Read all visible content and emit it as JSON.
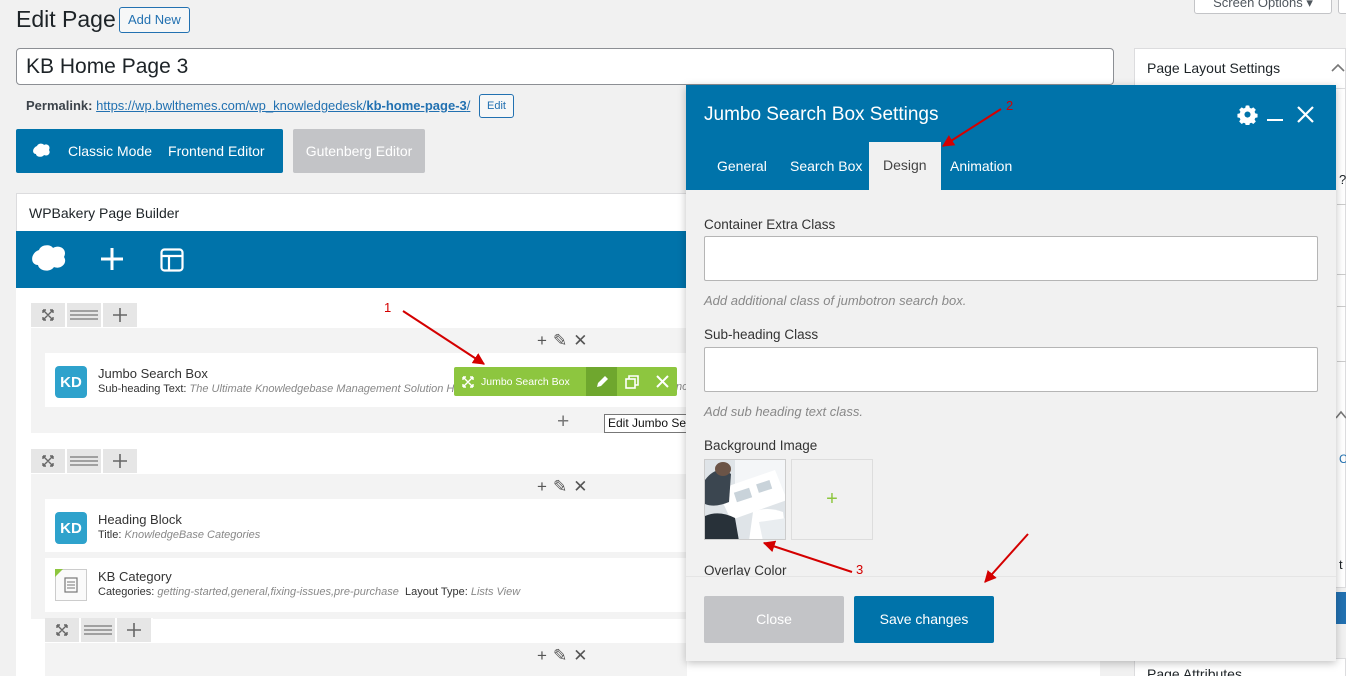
{
  "header": {
    "title": "Edit Page",
    "add_new": "Add New",
    "screen_options": "Screen Options ▾"
  },
  "post": {
    "title": "KB Home Page 3",
    "permalink_label": "Permalink:",
    "permalink_base": "https://wp.bwlthemes.com/wp_knowledgedesk/",
    "permalink_slug": "kb-home-page-3",
    "permalink_end": "/",
    "permalink_edit": "Edit"
  },
  "modes": {
    "classic": "Classic Mode",
    "frontend": "Frontend Editor",
    "gutenberg": "Gutenberg Editor"
  },
  "builder": {
    "title": "WPBakery Page Builder",
    "elements": [
      {
        "badge": "KD",
        "title": "Jumbo Search Box",
        "meta_label": "Sub-heading Text:",
        "meta_value": "The Ultimate Knowledgebase Management Solution H"
      },
      {
        "badge": "KD",
        "title": "Heading Block",
        "meta_label": "Title:",
        "meta_value": "KnowledgeBase Categories"
      },
      {
        "title": "KB Category",
        "meta_label": "Categories:",
        "meta_value": "getting-started,general,fixing-issues,pre-purchase",
        "meta_label2": "Layout Type:",
        "meta_value2": "Lists View"
      }
    ],
    "toolbar_label": "Jumbo Search Box",
    "toolbar_truncated": "nc",
    "tooltip": "Edit Jumbo Search Box"
  },
  "sidebar": {
    "page_layout_settings": "Page Layout Settings",
    "page_attributes": "Page Attributes",
    "partial_q": "?",
    "partial_c": "C",
    "partial_t": "t"
  },
  "modal": {
    "title": "Jumbo Search Box Settings",
    "tabs": [
      "General",
      "Search Box",
      "Design",
      "Animation"
    ],
    "active_tab": "Design",
    "fields": {
      "container_label": "Container Extra Class",
      "container_help": "Add additional class of jumbotron search box.",
      "subheading_label": "Sub-heading Class",
      "subheading_help": "Add sub heading text class.",
      "bg_label": "Background Image",
      "overlay_label": "Overlay Color"
    },
    "close": "Close",
    "save": "Save changes"
  },
  "annotations": [
    "1",
    "2",
    "3"
  ],
  "colors": {
    "wp_blue": "#0073aa",
    "green": "#8dc63f",
    "annot_red": "#d40000"
  }
}
